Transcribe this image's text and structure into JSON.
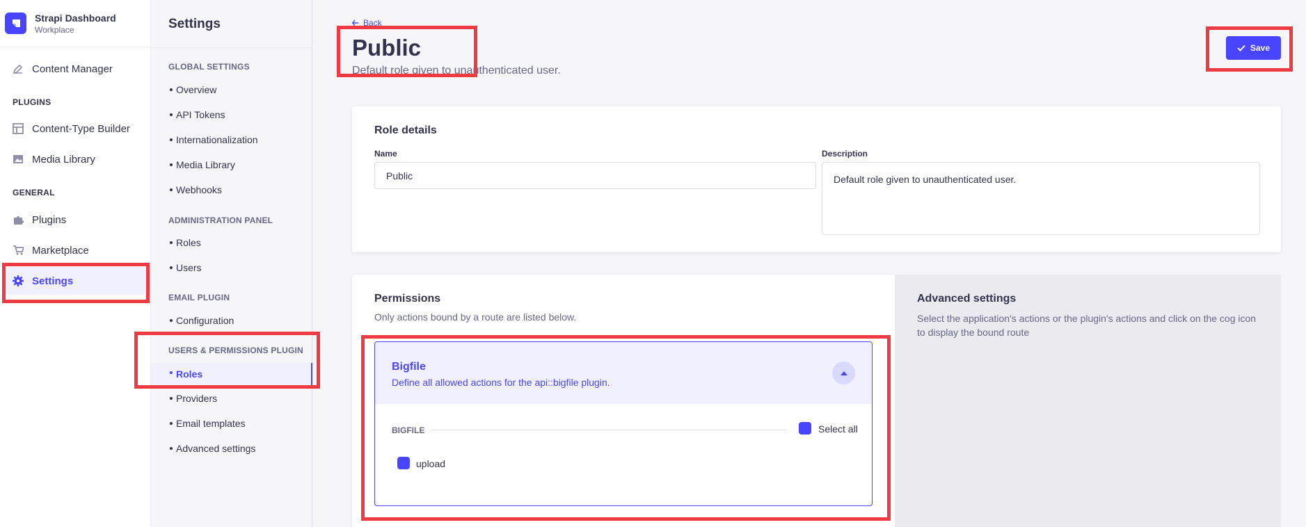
{
  "brand": {
    "title": "Strapi Dashboard",
    "subtitle": "Workplace"
  },
  "mainnav": {
    "content_manager": "Content Manager",
    "plugins_section": "PLUGINS",
    "content_type_builder": "Content-Type Builder",
    "media_library": "Media Library",
    "general_section": "GENERAL",
    "plugins": "Plugins",
    "marketplace": "Marketplace",
    "settings": "Settings"
  },
  "subnav": {
    "title": "Settings",
    "global_section": "GLOBAL SETTINGS",
    "global_items": [
      "Overview",
      "API Tokens",
      "Internationalization",
      "Media Library",
      "Webhooks"
    ],
    "admin_section": "ADMINISTRATION PANEL",
    "admin_items": [
      "Roles",
      "Users"
    ],
    "email_section": "EMAIL PLUGIN",
    "email_items": [
      "Configuration"
    ],
    "up_section": "USERS & PERMISSIONS PLUGIN",
    "up_items": [
      "Roles",
      "Providers",
      "Email templates",
      "Advanced settings"
    ]
  },
  "header": {
    "back": "Back",
    "title": "Public",
    "subtitle": "Default role given to unauthenticated user.",
    "save": "Save"
  },
  "role_details": {
    "title": "Role details",
    "name_label": "Name",
    "name_value": "Public",
    "description_label": "Description",
    "description_value": "Default role given to unauthenticated user."
  },
  "permissions": {
    "title": "Permissions",
    "subtitle": "Only actions bound by a route are listed below.",
    "accordion": {
      "title": "Bigfile",
      "description": "Define all allowed actions for the api::bigfile plugin.",
      "group_label": "BIGFILE",
      "select_all": "Select all",
      "actions": [
        "upload"
      ]
    }
  },
  "advanced": {
    "title": "Advanced settings",
    "description": "Select the application's actions or the plugin's actions and click on the cog icon to display the bound route"
  },
  "colors": {
    "primary": "#4945ff",
    "highlight": "#ee3b43"
  }
}
